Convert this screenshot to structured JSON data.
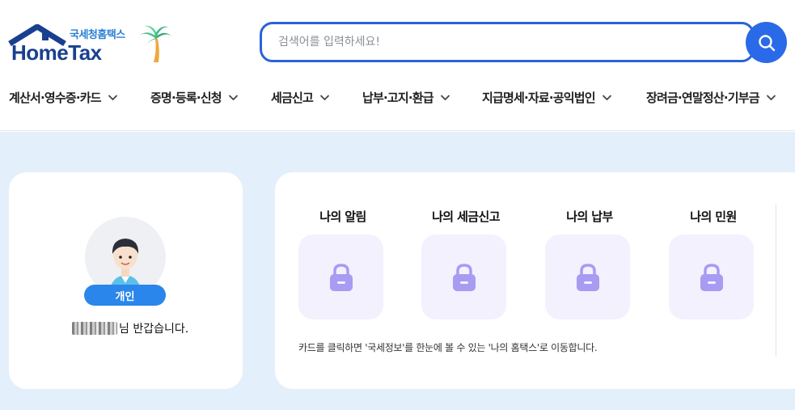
{
  "logo": {
    "small": "국세청홈택스",
    "big": "HomeTax"
  },
  "search": {
    "placeholder": "검색어를 입력하세요!"
  },
  "nav": [
    {
      "label": "계산서·영수증·카드"
    },
    {
      "label": "증명·등록·신청"
    },
    {
      "label": "세금신고"
    },
    {
      "label": "납부·고지·환급"
    },
    {
      "label": "지급명세·자료·공익법인"
    },
    {
      "label": "장려금·연말정산·기부금"
    }
  ],
  "profile": {
    "badge": "개인",
    "greeting": "님 반갑습니다."
  },
  "tiles": [
    {
      "title": "나의 알림",
      "icon": "lock-icon"
    },
    {
      "title": "나의 세금신고",
      "icon": "lock-icon"
    },
    {
      "title": "나의 납부",
      "icon": "lock-icon"
    },
    {
      "title": "나의 민원",
      "icon": "lock-icon"
    }
  ],
  "note": "카드를 클릭하면 '국세정보'를 한눈에 볼 수 있는 '나의 홈택스'로 이동합니다.",
  "colors": {
    "brand_blue": "#2a6ae8",
    "lock_purple": "#a89bf2",
    "tile_bg": "#f3f1fe",
    "page_bg": "#e3f0fb"
  }
}
